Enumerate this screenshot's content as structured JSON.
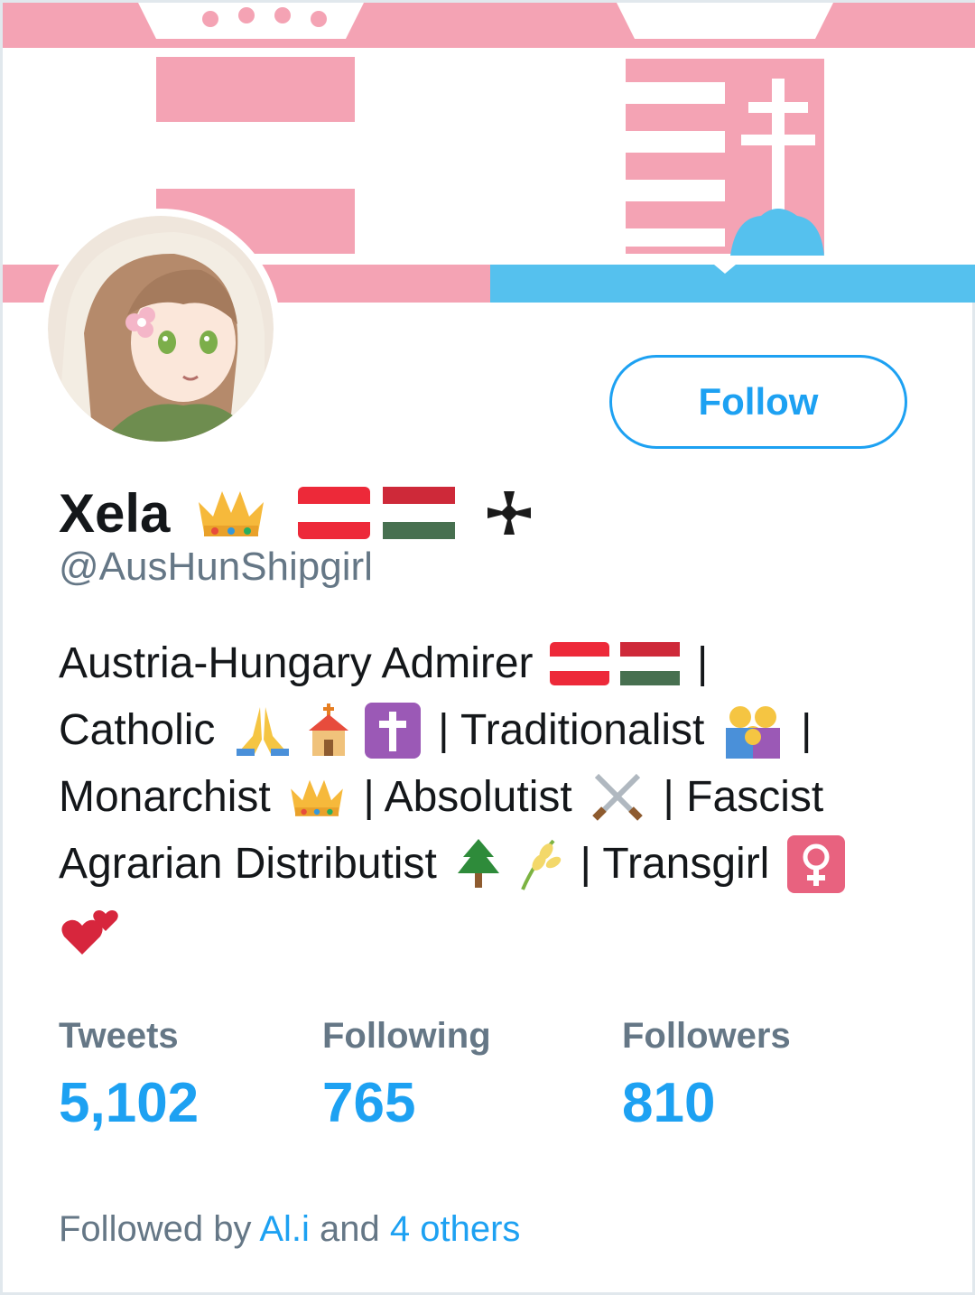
{
  "profile": {
    "display_name": "Xela",
    "handle": "@AusHunShipgirl",
    "follow_label": "Follow"
  },
  "bio": {
    "line1": "Austria-Hungary Admirer",
    "line1_end": " |",
    "line2_a": "Catholic ",
    "line2_b": " | Traditionalist ",
    "line2_c": " |",
    "line3_a": "Monarchist ",
    "line3_b": " | Absolutist ",
    "line3_c": " | Fascist",
    "line4_a": "Agrarian Distributist ",
    "line4_b": " | Transgirl "
  },
  "icons": {
    "name": [
      "crown-icon",
      "austria-flag-icon",
      "hungary-flag-icon",
      "iron-cross-icon"
    ],
    "bio": [
      "austria-flag-icon",
      "hungary-flag-icon",
      "praying-hands-icon",
      "church-icon",
      "latin-cross-icon",
      "family-icon",
      "crown-icon",
      "crossed-swords-icon",
      "evergreen-tree-icon",
      "rice-ear-icon",
      "female-sign-icon",
      "two-hearts-icon"
    ]
  },
  "stats": {
    "tweets_label": "Tweets",
    "tweets_value": "5,102",
    "following_label": "Following",
    "following_value": "765",
    "followers_label": "Followers",
    "followers_value": "810"
  },
  "followed_by": {
    "prefix": "Followed by ",
    "user": "Al.i",
    "middle": " and ",
    "others": "4 others"
  },
  "colors": {
    "accent": "#1da1f2",
    "banner_pink": "#f4a3b4",
    "banner_blue": "#55c1ee",
    "secondary_text": "#657786"
  }
}
